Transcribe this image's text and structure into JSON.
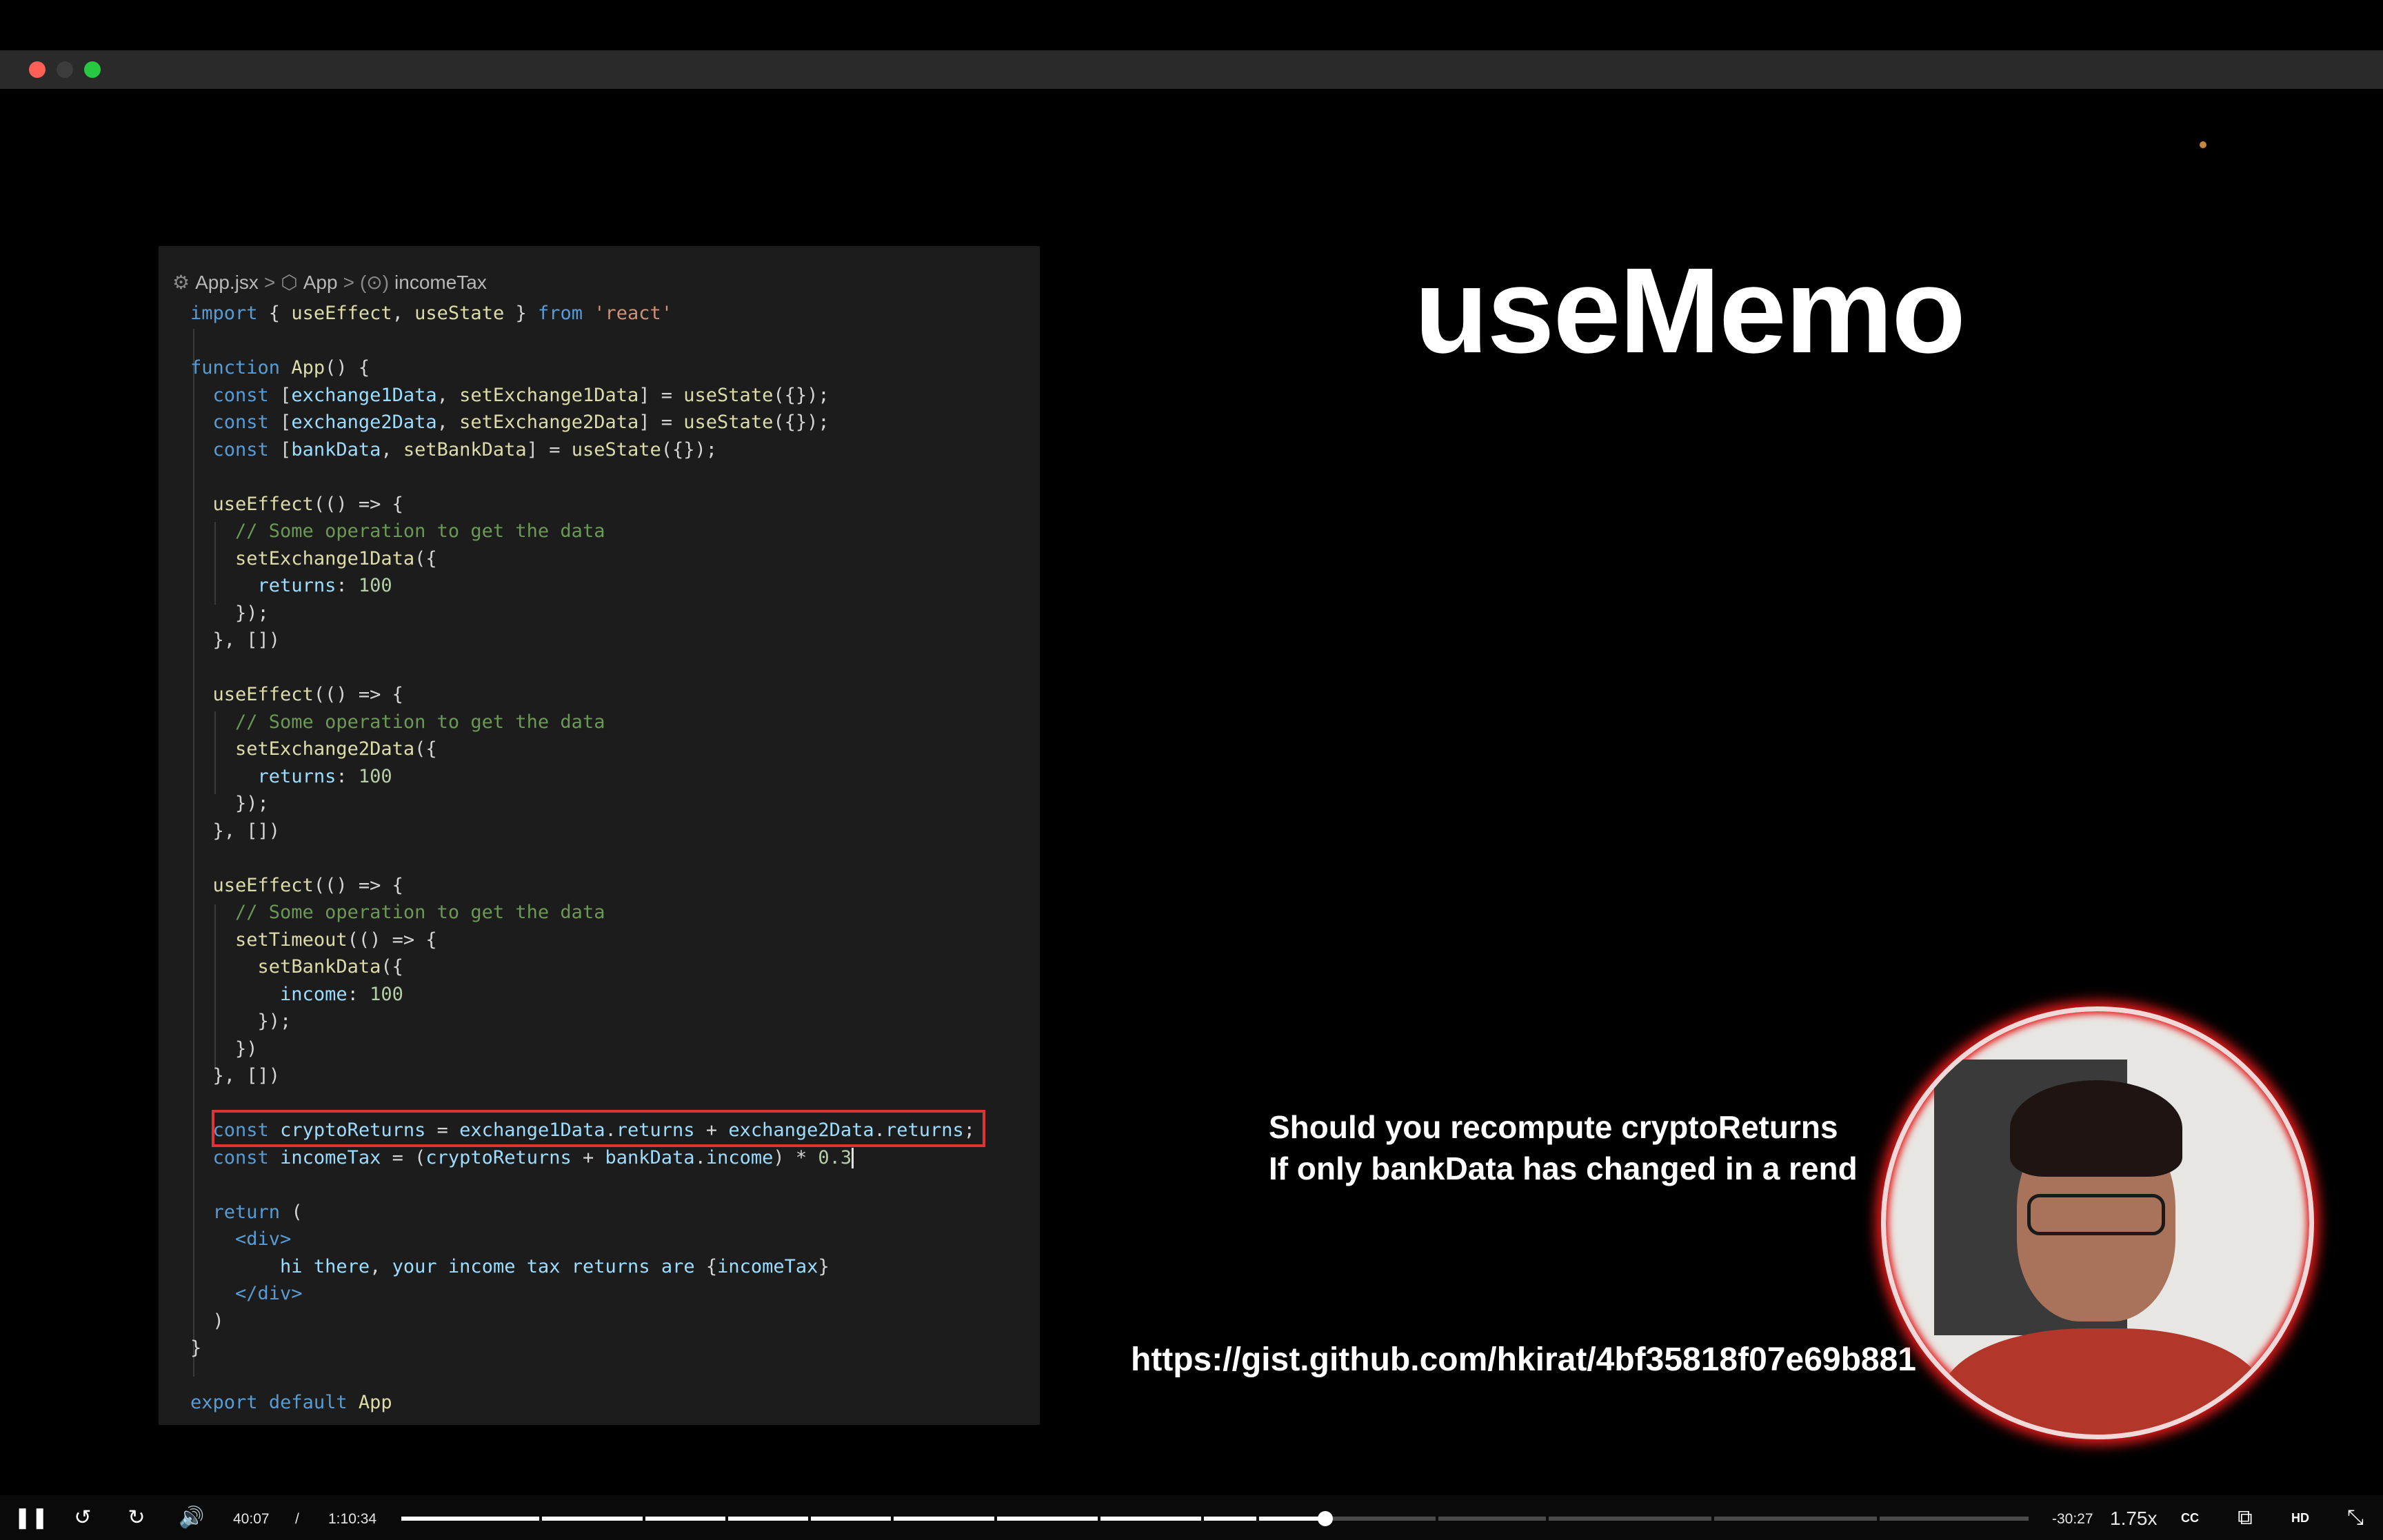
{
  "window": {
    "close_color": "#ff5f57",
    "minimize_color": "#3c3c3c",
    "maximize_color": "#28c840"
  },
  "editor": {
    "breadcrumb": {
      "file": "App.jsx",
      "component": "App",
      "symbol": "incomeTax"
    },
    "code_lines": [
      "import { useEffect, useState } from 'react'",
      "",
      "function App() {",
      "  const [exchange1Data, setExchange1Data] = useState({});",
      "  const [exchange2Data, setExchange2Data] = useState({});",
      "  const [bankData, setBankData] = useState({});",
      "",
      "  useEffect(() => {",
      "    // Some operation to get the data",
      "    setExchange1Data({",
      "      returns: 100",
      "    });",
      "  }, [])",
      "",
      "  useEffect(() => {",
      "    // Some operation to get the data",
      "    setExchange2Data({",
      "      returns: 100",
      "    });",
      "  }, [])",
      "",
      "  useEffect(() => {",
      "    // Some operation to get the data",
      "    setTimeout(() => {",
      "      setBankData({",
      "        income: 100",
      "      });",
      "    })",
      "  }, [])",
      "",
      "  const cryptoReturns = exchange1Data.returns + exchange2Data.returns;",
      "  const incomeTax = (cryptoReturns + bankData.income) * 0.3",
      "",
      "  return (",
      "    <div>",
      "        hi there, your income tax returns are {incomeTax}",
      "    </div>",
      "  )",
      "}",
      "",
      "export default App"
    ],
    "highlight_line_index": 30,
    "highlight_color": "#e03434"
  },
  "slide": {
    "title": "useMemo",
    "note_line1": "Should you recompute cryptoReturns",
    "note_line2": "If only bankData has changed in a rend",
    "gist_url": "https://gist.github.com/hkirat/4bf35818f07e69b881",
    "webcam_ring_color": "#e31b1b"
  },
  "player": {
    "current_time": "40:07",
    "separator": "/",
    "duration": "1:10:34",
    "remaining": "-30:27",
    "speed": "1.75x",
    "progress_fraction": 0.568,
    "icons": [
      "pause-icon",
      "rewind-icon",
      "forward-icon",
      "volume-icon",
      "captions-icon",
      "pip-icon",
      "hd-icon",
      "exit-fullscreen-icon"
    ]
  }
}
